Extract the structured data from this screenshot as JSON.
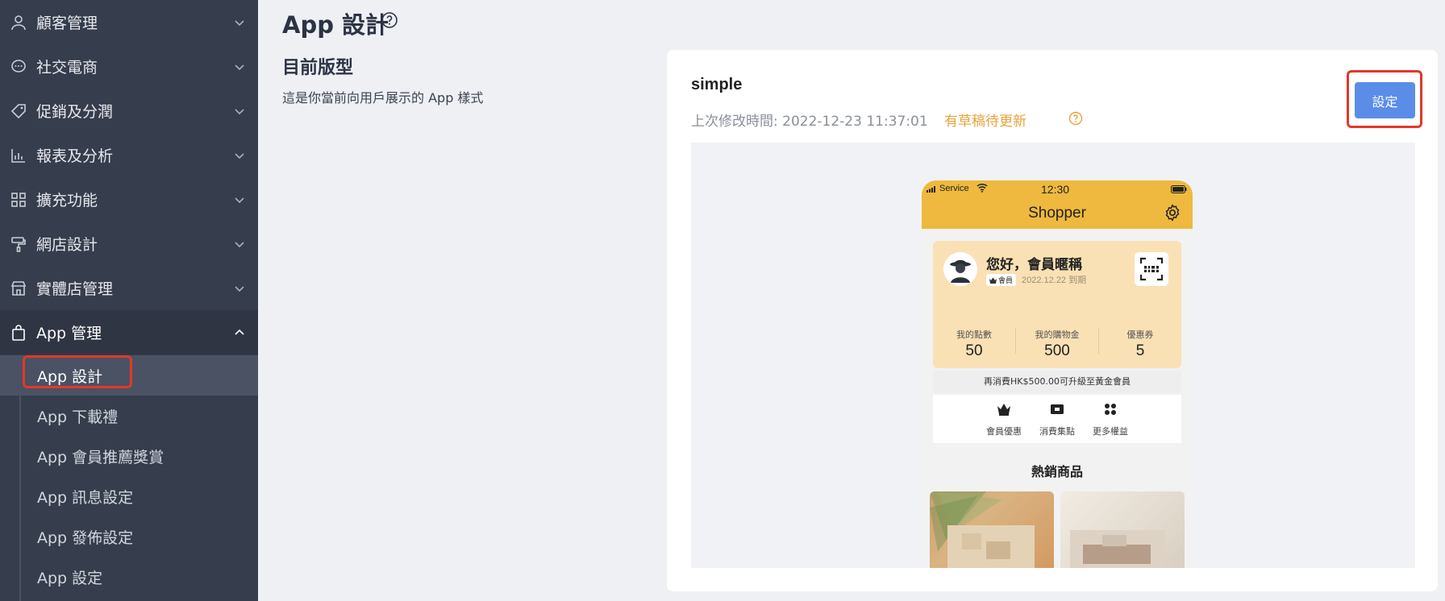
{
  "sidebar": {
    "items": [
      {
        "label": "顧客管理",
        "icon": "user-icon"
      },
      {
        "label": "社交電商",
        "icon": "chat-icon"
      },
      {
        "label": "促銷及分潤",
        "icon": "tag-icon"
      },
      {
        "label": "報表及分析",
        "icon": "chart-icon"
      },
      {
        "label": "擴充功能",
        "icon": "grid-icon"
      },
      {
        "label": "網店設計",
        "icon": "paint-roller-icon"
      },
      {
        "label": "實體店管理",
        "icon": "store-icon"
      },
      {
        "label": "App 管理",
        "icon": "shopping-bag-icon"
      }
    ],
    "sub_items": [
      {
        "label": "App 設計"
      },
      {
        "label": "App 下載禮"
      },
      {
        "label": "App 會員推薦獎賞"
      },
      {
        "label": "App 訊息設定"
      },
      {
        "label": "App 發佈設定"
      },
      {
        "label": "App 設定"
      }
    ]
  },
  "main": {
    "page_title": "App 設計",
    "section_title": "目前版型",
    "section_desc": "這是你當前向用戶展示的 App 樣式",
    "template_name": "simple",
    "last_modified": "上次修改時間: 2022-12-23 11:37:01",
    "draft_notice": "有草稿待更新",
    "settings_button": "設定"
  },
  "phone": {
    "carrier": "Service",
    "time": "12:30",
    "app_title": "Shopper",
    "greeting": "您好，會員暱稱",
    "badge": "會員",
    "expiry": "2022.12.22 到期",
    "stats": [
      {
        "label": "我的點數",
        "value": "50"
      },
      {
        "label": "我的購物金",
        "value": "500"
      },
      {
        "label": "優惠券",
        "value": "5"
      }
    ],
    "upgrade_text": "再消費HK$500.00可升級至黃金會員",
    "perks": [
      {
        "label": "會員優惠",
        "icon": "crown-icon"
      },
      {
        "label": "消費集點",
        "icon": "ticket-icon"
      },
      {
        "label": "更多權益",
        "icon": "dots-icon"
      }
    ],
    "hot_title": "熱銷商品"
  },
  "colors": {
    "sidebar_bg": "#363d4d",
    "accent_button": "#5b8de8",
    "highlight_red": "#e2382b",
    "draft_orange": "#e9a23b",
    "app_yellow": "#eeb93e",
    "member_card": "#fae1b5"
  }
}
